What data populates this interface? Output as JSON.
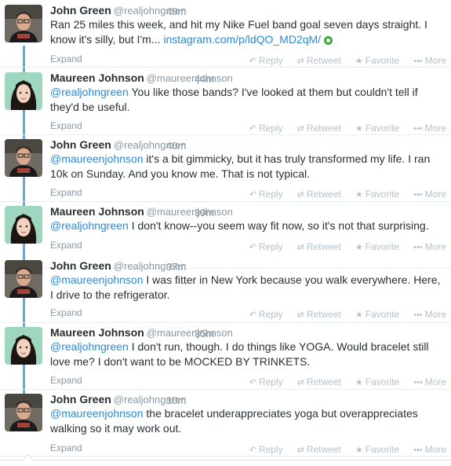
{
  "tweets": [
    {
      "author": "john",
      "name": "John Green",
      "handle": "@realjohngreen",
      "time": "49m",
      "segments": [
        {
          "type": "text",
          "text": "Ran 25 miles this week, and hit my Nike Fuel band goal seven days straight. I know it's silly, but I'm... "
        },
        {
          "type": "link",
          "text": "instagram.com/p/ldQO_MD2qM/"
        },
        {
          "type": "media",
          "text": "",
          "icon": "instagram-media-icon"
        }
      ],
      "expand": "Expand"
    },
    {
      "author": "maureen",
      "name": "Maureen Johnson",
      "handle": "@maureenjohnson",
      "time": "44m",
      "segments": [
        {
          "type": "mention",
          "text": "@realjohngreen"
        },
        {
          "type": "text",
          "text": " You like those bands? I've looked at them but couldn't tell if they'd be useful."
        }
      ],
      "expand": "Expand"
    },
    {
      "author": "john",
      "name": "John Green",
      "handle": "@realjohngreen",
      "time": "40m",
      "segments": [
        {
          "type": "mention",
          "text": "@maureenjohnson"
        },
        {
          "type": "text",
          "text": " it's a bit gimmicky, but it has truly transformed my life. I ran 10k on Sunday. And you know me. That is not typical."
        }
      ],
      "expand": "Expand"
    },
    {
      "author": "maureen",
      "name": "Maureen Johnson",
      "handle": "@maureenjohnson",
      "time": "39m",
      "segments": [
        {
          "type": "mention",
          "text": "@realjohngreen"
        },
        {
          "type": "text",
          "text": " I don't know--you seem way fit now, so it's not that surprising."
        }
      ],
      "expand": "Expand"
    },
    {
      "author": "john",
      "name": "John Green",
      "handle": "@realjohngreen",
      "time": "37m",
      "segments": [
        {
          "type": "mention",
          "text": "@maureenjohnson"
        },
        {
          "type": "text",
          "text": " I was fitter in New York because you walk everywhere. Here, I drive to the refrigerator."
        }
      ],
      "expand": "Expand"
    },
    {
      "author": "maureen",
      "name": "Maureen Johnson",
      "handle": "@maureenjohnson",
      "time": "35m",
      "segments": [
        {
          "type": "mention",
          "text": "@realjohngreen"
        },
        {
          "type": "text",
          "text": " I don't run, though. I do things like YOGA. Would bracelet still love me? I don't want to be MOCKED BY TRINKETS."
        }
      ],
      "expand": "Expand"
    },
    {
      "author": "john",
      "name": "John Green",
      "handle": "@realjohngreen",
      "time": "10m",
      "segments": [
        {
          "type": "mention",
          "text": "@maureenjohnson"
        },
        {
          "type": "text",
          "text": " the bracelet underappreciates yoga but overappreciates walking so it may work out."
        }
      ],
      "expand": "Expand"
    }
  ],
  "actions": {
    "reply": {
      "label": "Reply",
      "icon": "reply-icon"
    },
    "retweet": {
      "label": "Retweet",
      "icon": "retweet-icon"
    },
    "favorite": {
      "label": "Favorite",
      "icon": "star-icon"
    },
    "more": {
      "label": "More",
      "icon": "more-dots-icon"
    }
  },
  "colors": {
    "link": "#2a8ad6",
    "thread_line": "#5ea9dd",
    "muted": "#8899a6",
    "action": "#b5c2cc"
  }
}
